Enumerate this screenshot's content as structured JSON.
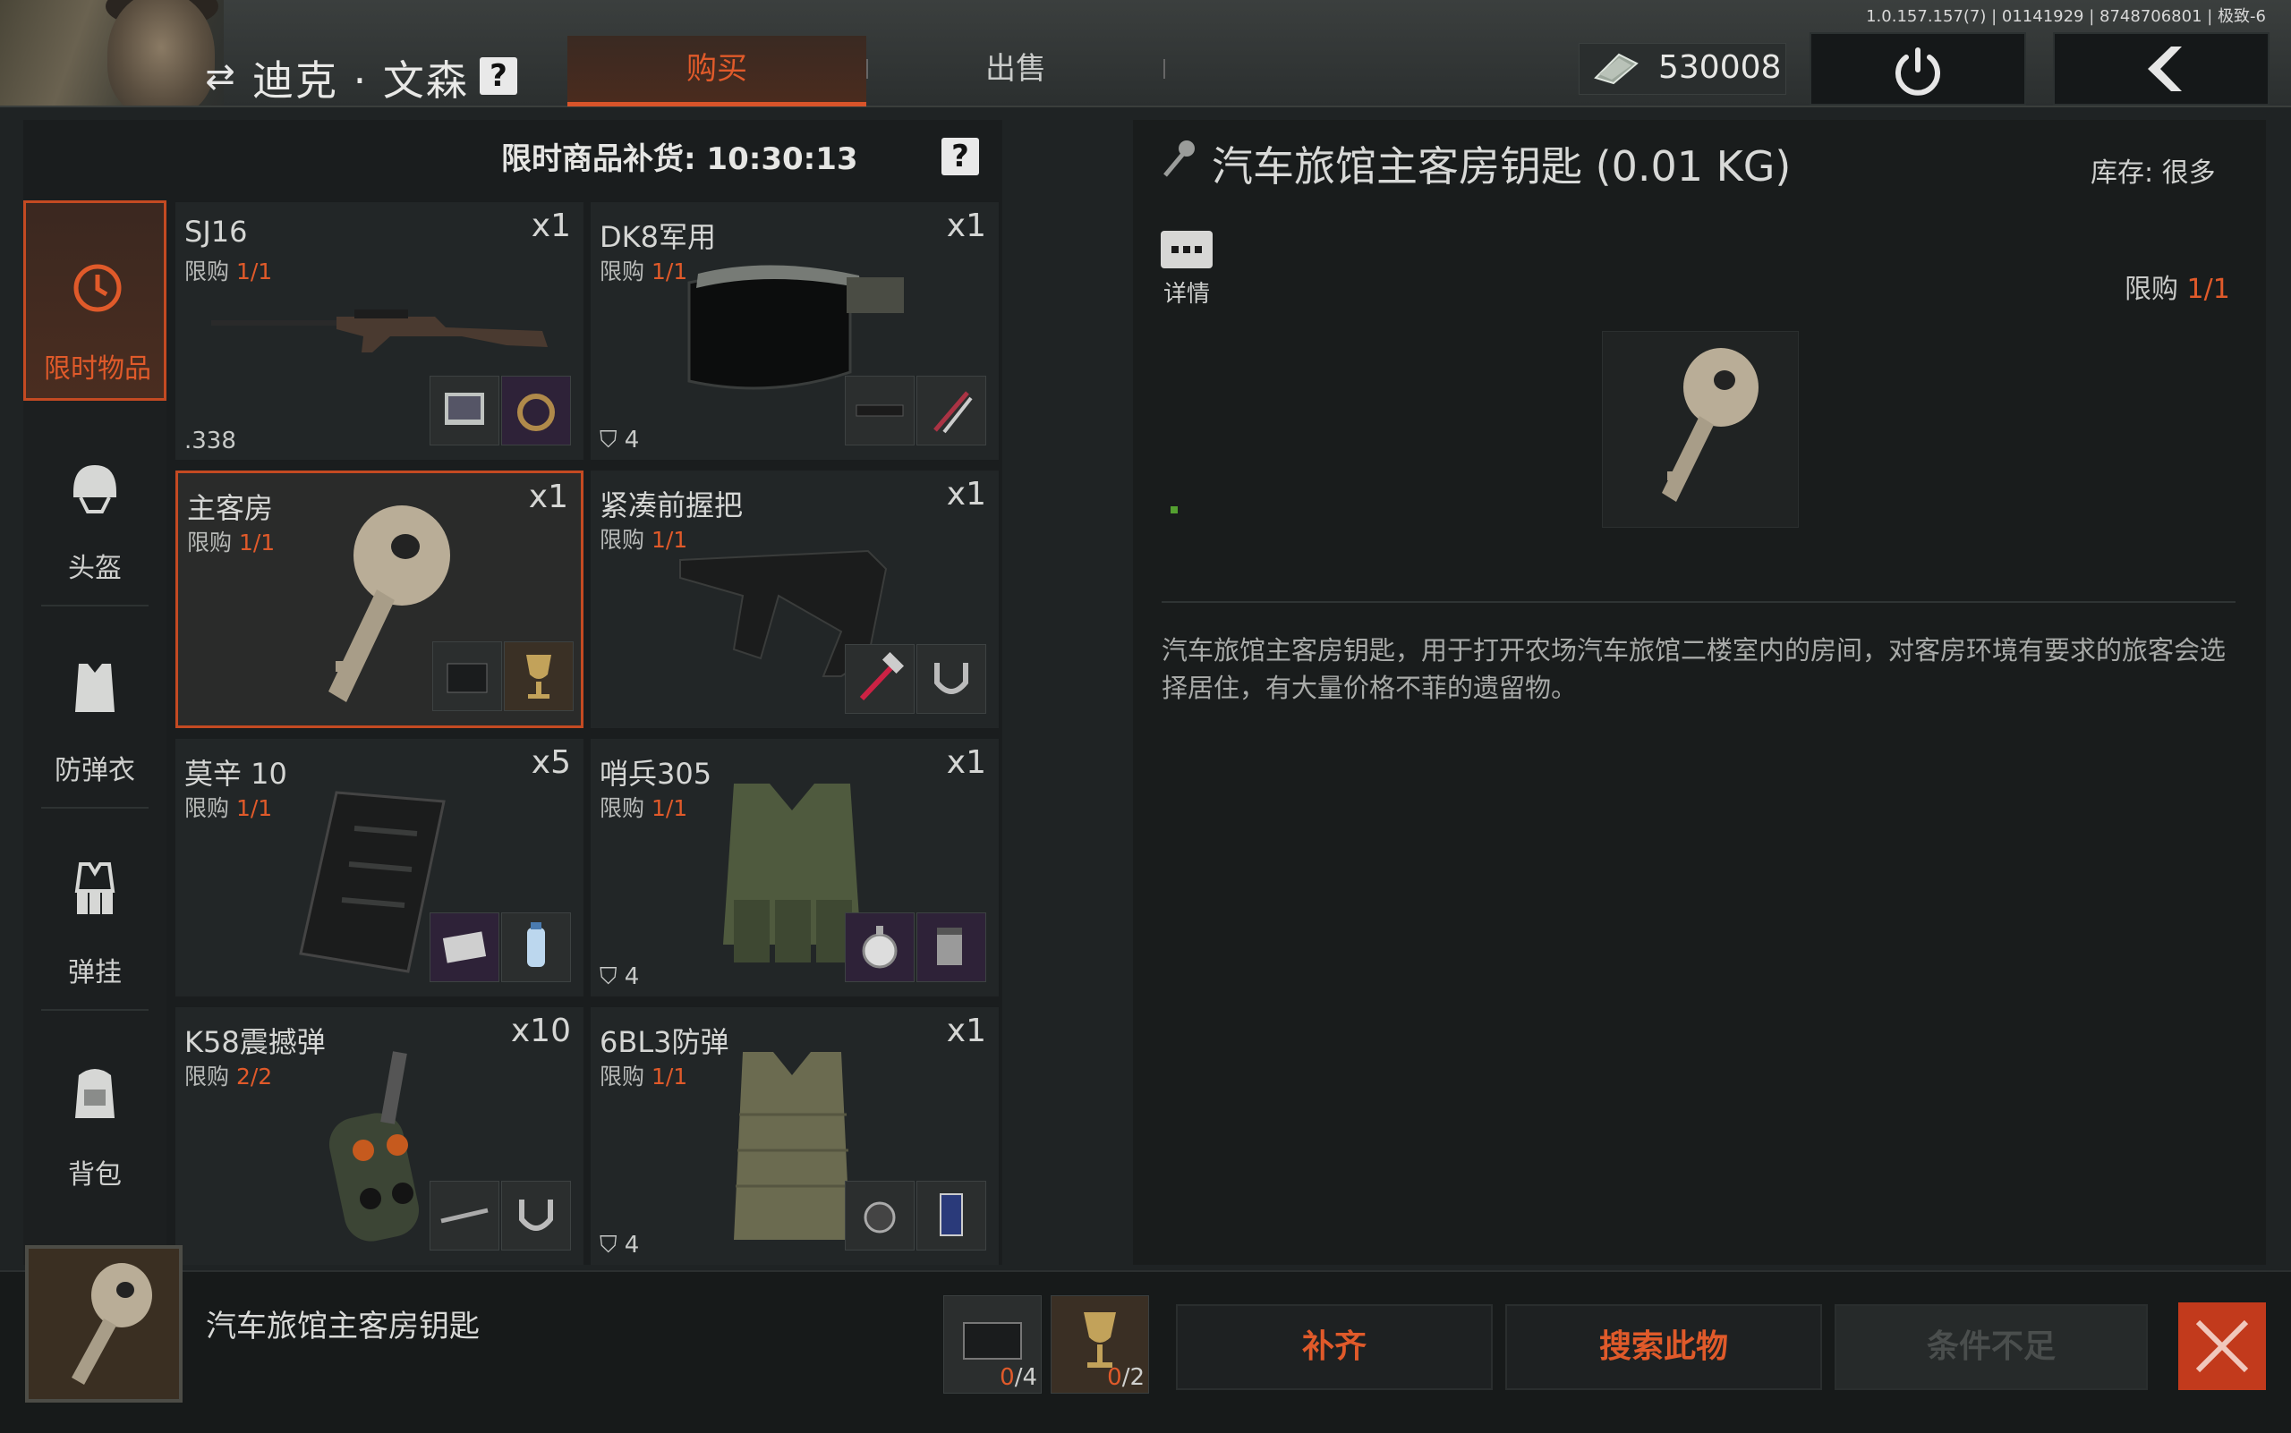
{
  "header": {
    "trader_name": "迪克 · 文森",
    "help": "?",
    "tabs": {
      "buy": "购买",
      "sell": "出售"
    },
    "money": "530008",
    "version": "1.0.157.157(7) | 01141929 | 8748706801 | 极致-6"
  },
  "shop": {
    "restock": "限时商品补货: 10:30:13",
    "categories": [
      {
        "label": "限时物品",
        "icon": "clock-icon"
      },
      {
        "label": "头盔",
        "icon": "helmet-icon"
      },
      {
        "label": "防弹衣",
        "icon": "vest-icon"
      },
      {
        "label": "弹挂",
        "icon": "rig-icon"
      },
      {
        "label": "背包",
        "icon": "backpack-icon"
      }
    ],
    "limit_prefix": "限购",
    "items": [
      {
        "name": "SJ16",
        "qty": "x1",
        "limit": "1/1",
        "sub": ".338"
      },
      {
        "name": "DK8军用",
        "qty": "x1",
        "limit": "1/1",
        "sub": "4"
      },
      {
        "name": "主客房",
        "qty": "x1",
        "limit": "1/1",
        "sub": ""
      },
      {
        "name": "紧凑前握把",
        "qty": "x1",
        "limit": "1/1",
        "sub": ""
      },
      {
        "name": "莫辛 10",
        "qty": "x5",
        "limit": "1/1",
        "sub": ""
      },
      {
        "name": "哨兵305",
        "qty": "x1",
        "limit": "1/1",
        "sub": "4"
      },
      {
        "name": "K58震撼弹",
        "qty": "x10",
        "limit": "2/2",
        "sub": ""
      },
      {
        "name": "6BL3防弹",
        "qty": "x1",
        "limit": "1/1",
        "sub": "4"
      }
    ]
  },
  "detail": {
    "title": "汽车旅馆主客房钥匙 (0.01 KG)",
    "stock": "库存: 很多",
    "details_label": "详情",
    "limit_label": "限购",
    "limit_value": "1/1",
    "description": "汽车旅馆主客房钥匙，用于打开农场汽车旅馆二楼室内的房间，对客房环境有要求的旅客会选择居住，有大量价格不菲的遗留物。"
  },
  "bottom": {
    "selected_name": "汽车旅馆主客房钥匙",
    "costs": [
      {
        "have": "0",
        "need": "/4"
      },
      {
        "have": "0",
        "need": "/2"
      }
    ],
    "buttons": {
      "fill": "补齐",
      "search": "搜索此物",
      "insufficient": "条件不足"
    }
  }
}
